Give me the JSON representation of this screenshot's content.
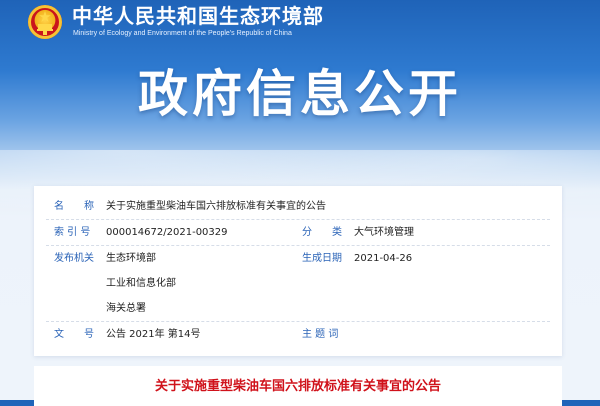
{
  "header": {
    "ministry_cn": "中华人民共和国生态环境部",
    "ministry_en": "Ministry of Ecology and Environment of the People's Republic of China"
  },
  "hero": {
    "title": "政府信息公开"
  },
  "info": {
    "name_label": "名　　称",
    "name_value": "关于实施重型柴油车国六排放标准有关事宜的公告",
    "index_label": "索 引 号",
    "index_value": "000014672/2021-00329",
    "category_label": "分　　类",
    "category_value": "大气环境管理",
    "issuer_label": "发布机关",
    "issuers": [
      "生态环境部",
      "工业和信息化部",
      "海关总署"
    ],
    "date_label": "生成日期",
    "date_value": "2021-04-26",
    "doc_label": "文　　号",
    "doc_value": "公告 2021年 第14号",
    "keywords_label": "主 题 词",
    "keywords_value": ""
  },
  "announcement": {
    "title": "关于实施重型柴油车国六排放标准有关事宜的公告"
  },
  "colors": {
    "label": "#2a63b7",
    "header_blue": "#1f63b8",
    "title_red": "#d0121b"
  },
  "icons": {
    "emblem": "national-emblem-icon"
  }
}
